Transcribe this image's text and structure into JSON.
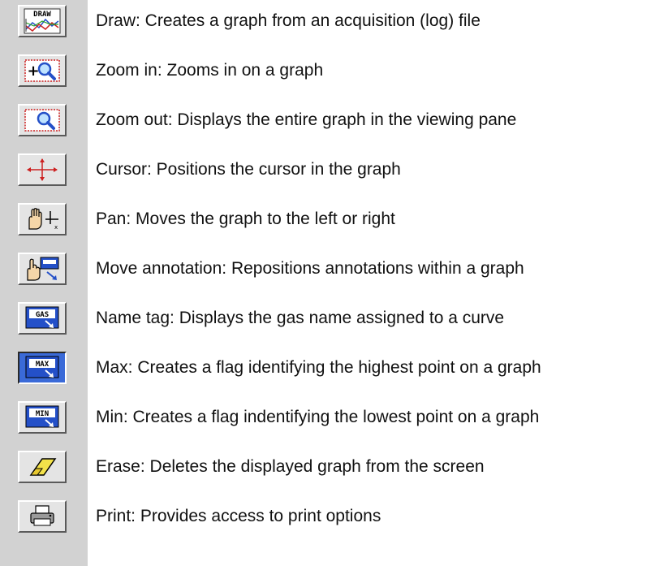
{
  "tools": [
    {
      "id": "draw",
      "icon": "draw-graph-icon",
      "text": "Draw:  Creates a graph from an acquisition (log) file"
    },
    {
      "id": "zoom-in",
      "icon": "zoom-in-icon",
      "text": "Zoom in:  Zooms in on a graph"
    },
    {
      "id": "zoom-out",
      "icon": "zoom-out-icon",
      "text": "Zoom out:  Displays the entire graph in the viewing pane"
    },
    {
      "id": "cursor",
      "icon": "crosshair-icon",
      "text": "Cursor:  Positions the cursor in the graph"
    },
    {
      "id": "pan",
      "icon": "hand-pan-icon",
      "text": "Pan: Moves the graph to the left or right"
    },
    {
      "id": "move-annotation",
      "icon": "move-annotation-icon",
      "text": "Move annotation:  Repositions annotations within a graph"
    },
    {
      "id": "name-tag",
      "icon": "gas-tag-icon",
      "text": "Name tag:  Displays the gas name assigned to a curve"
    },
    {
      "id": "max",
      "icon": "max-flag-icon",
      "text": "Max:  Creates a flag identifying the highest point on a graph"
    },
    {
      "id": "min",
      "icon": "min-flag-icon",
      "text": "Min:  Creates a flag indentifying the lowest point on a graph"
    },
    {
      "id": "erase",
      "icon": "eraser-icon",
      "text": "Erase:  Deletes the displayed graph from the screen"
    },
    {
      "id": "print",
      "icon": "printer-icon",
      "text": "Print:  Provides access to print options"
    }
  ],
  "icon_labels": {
    "draw": "DRAW",
    "gas": "GAS",
    "max": "MAX",
    "min": "MIN"
  },
  "colors": {
    "strip": "#d2d2d2",
    "button_face": "#e4e4e4",
    "accent_blue": "#2450c8",
    "accent_red": "#cc2020",
    "eraser_yellow": "#f3e24a"
  }
}
